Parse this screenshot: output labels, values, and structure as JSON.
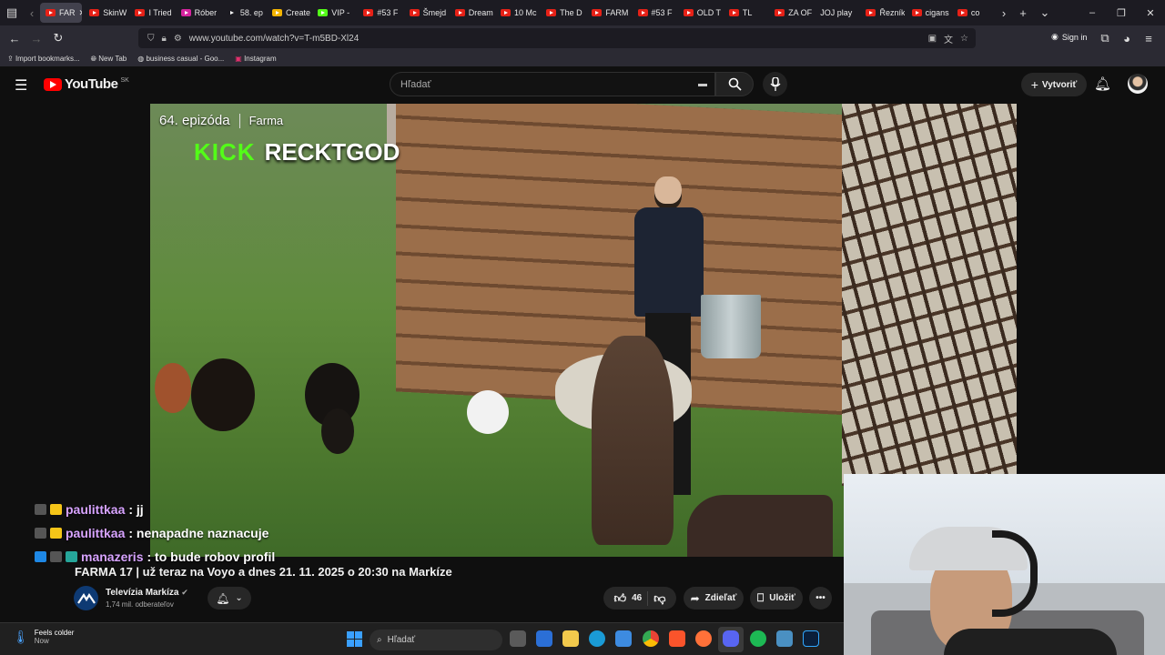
{
  "browser": {
    "tabs": [
      {
        "label": "FAR",
        "active": true,
        "favicon": "youtube-icon"
      },
      {
        "label": "SkinW",
        "favicon": "youtube-icon"
      },
      {
        "label": "I Tried",
        "favicon": "youtube-icon"
      },
      {
        "label": "Róber",
        "favicon": "instagram-icon"
      },
      {
        "label": "58. ep",
        "favicon": "v-icon"
      },
      {
        "label": "Create",
        "favicon": "docs-icon"
      },
      {
        "label": "VIP - ",
        "favicon": "kick-icon"
      },
      {
        "label": "#53 F",
        "favicon": "youtube-icon"
      },
      {
        "label": "Šmejd",
        "favicon": "youtube-icon"
      },
      {
        "label": "Dream",
        "favicon": "youtube-icon"
      },
      {
        "label": "10 Mc",
        "favicon": "youtube-icon"
      },
      {
        "label": "The D",
        "favicon": "youtube-icon"
      },
      {
        "label": "FARM",
        "favicon": "youtube-icon"
      },
      {
        "label": "#53 F",
        "favicon": "youtube-icon"
      },
      {
        "label": "OLD T",
        "favicon": "youtube-icon"
      },
      {
        "label": "TL",
        "favicon": "youtube-icon"
      },
      {
        "label": "ZA OF",
        "favicon": "youtube-icon"
      },
      {
        "label": "JOJ play",
        "favicon": "none"
      },
      {
        "label": "Řezník",
        "favicon": "youtube-icon"
      },
      {
        "label": "cigans",
        "favicon": "youtube-icon"
      },
      {
        "label": "co",
        "favicon": "youtube-icon"
      }
    ],
    "url": "www.youtube.com/watch?v=T-m5BD-Xl24",
    "bookmarks": [
      "Import bookmarks...",
      "New Tab",
      "business casual - Goo...",
      "Instagram"
    ]
  },
  "youtube": {
    "logo_text": "YouTube",
    "region": "SK",
    "search_placeholder": "Hľadať",
    "create_label": "Vytvoriť"
  },
  "video_overlay": {
    "episode": "64. epizóda",
    "show": "Farma",
    "kick_logo": "KICK",
    "streamer": "RECKTGOD"
  },
  "chat": [
    {
      "user": "paulittkaa",
      "message": ": jj"
    },
    {
      "user": "paulittkaa",
      "message": ": nenapadne naznacuje"
    },
    {
      "user": "manazeris",
      "message": ": to bude robov profil"
    }
  ],
  "video": {
    "title": "FARMA 17 | už teraz na Voyo a dnes 21. 11. 2025 o 20:30 na Markíze",
    "channel": "Televízia Markíza",
    "subscribers": "1,74 mil. odberateľov",
    "likes": "46",
    "share_label": "Zdieľať",
    "save_label": "Uložiť"
  },
  "taskbar": {
    "weather_title": "Feels colder",
    "weather_sub": "Now",
    "search_placeholder": "Hľadať"
  },
  "colors": {
    "accent_red": "#ff0000",
    "kick_green": "#53fc18",
    "chat_user": "#d7a3ff"
  }
}
